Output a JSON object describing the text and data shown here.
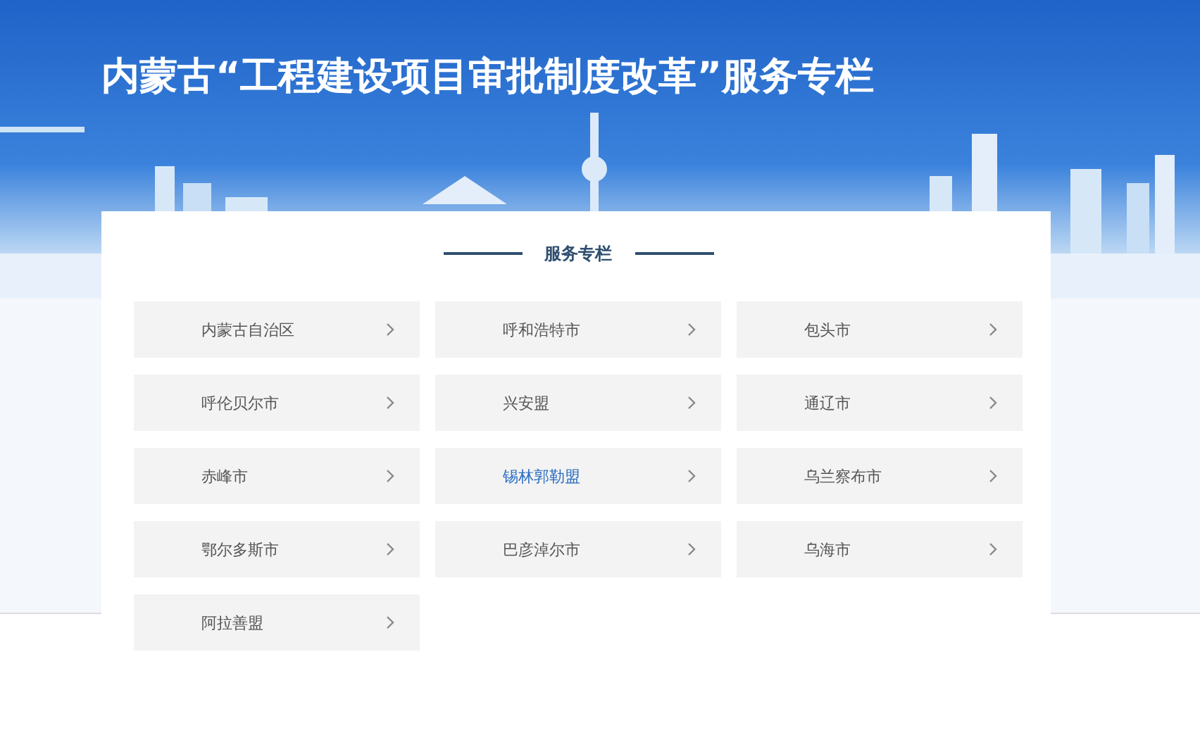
{
  "banner": {
    "title": "内蒙古“工程建设项目审批制度改革”服务专栏"
  },
  "section": {
    "heading": "服务专栏",
    "items": [
      {
        "label": "内蒙古自治区",
        "selected": false
      },
      {
        "label": "呼和浩特市",
        "selected": false
      },
      {
        "label": "包头市",
        "selected": false
      },
      {
        "label": "呼伦贝尔市",
        "selected": false
      },
      {
        "label": "兴安盟",
        "selected": false
      },
      {
        "label": "通辽市",
        "selected": false
      },
      {
        "label": "赤峰市",
        "selected": false
      },
      {
        "label": "锡林郭勒盟",
        "selected": true
      },
      {
        "label": "乌兰察布市",
        "selected": false
      },
      {
        "label": "鄂尔多斯市",
        "selected": false
      },
      {
        "label": "巴彦淖尔市",
        "selected": false
      },
      {
        "label": "乌海市",
        "selected": false
      },
      {
        "label": "阿拉善盟",
        "selected": false
      }
    ]
  }
}
